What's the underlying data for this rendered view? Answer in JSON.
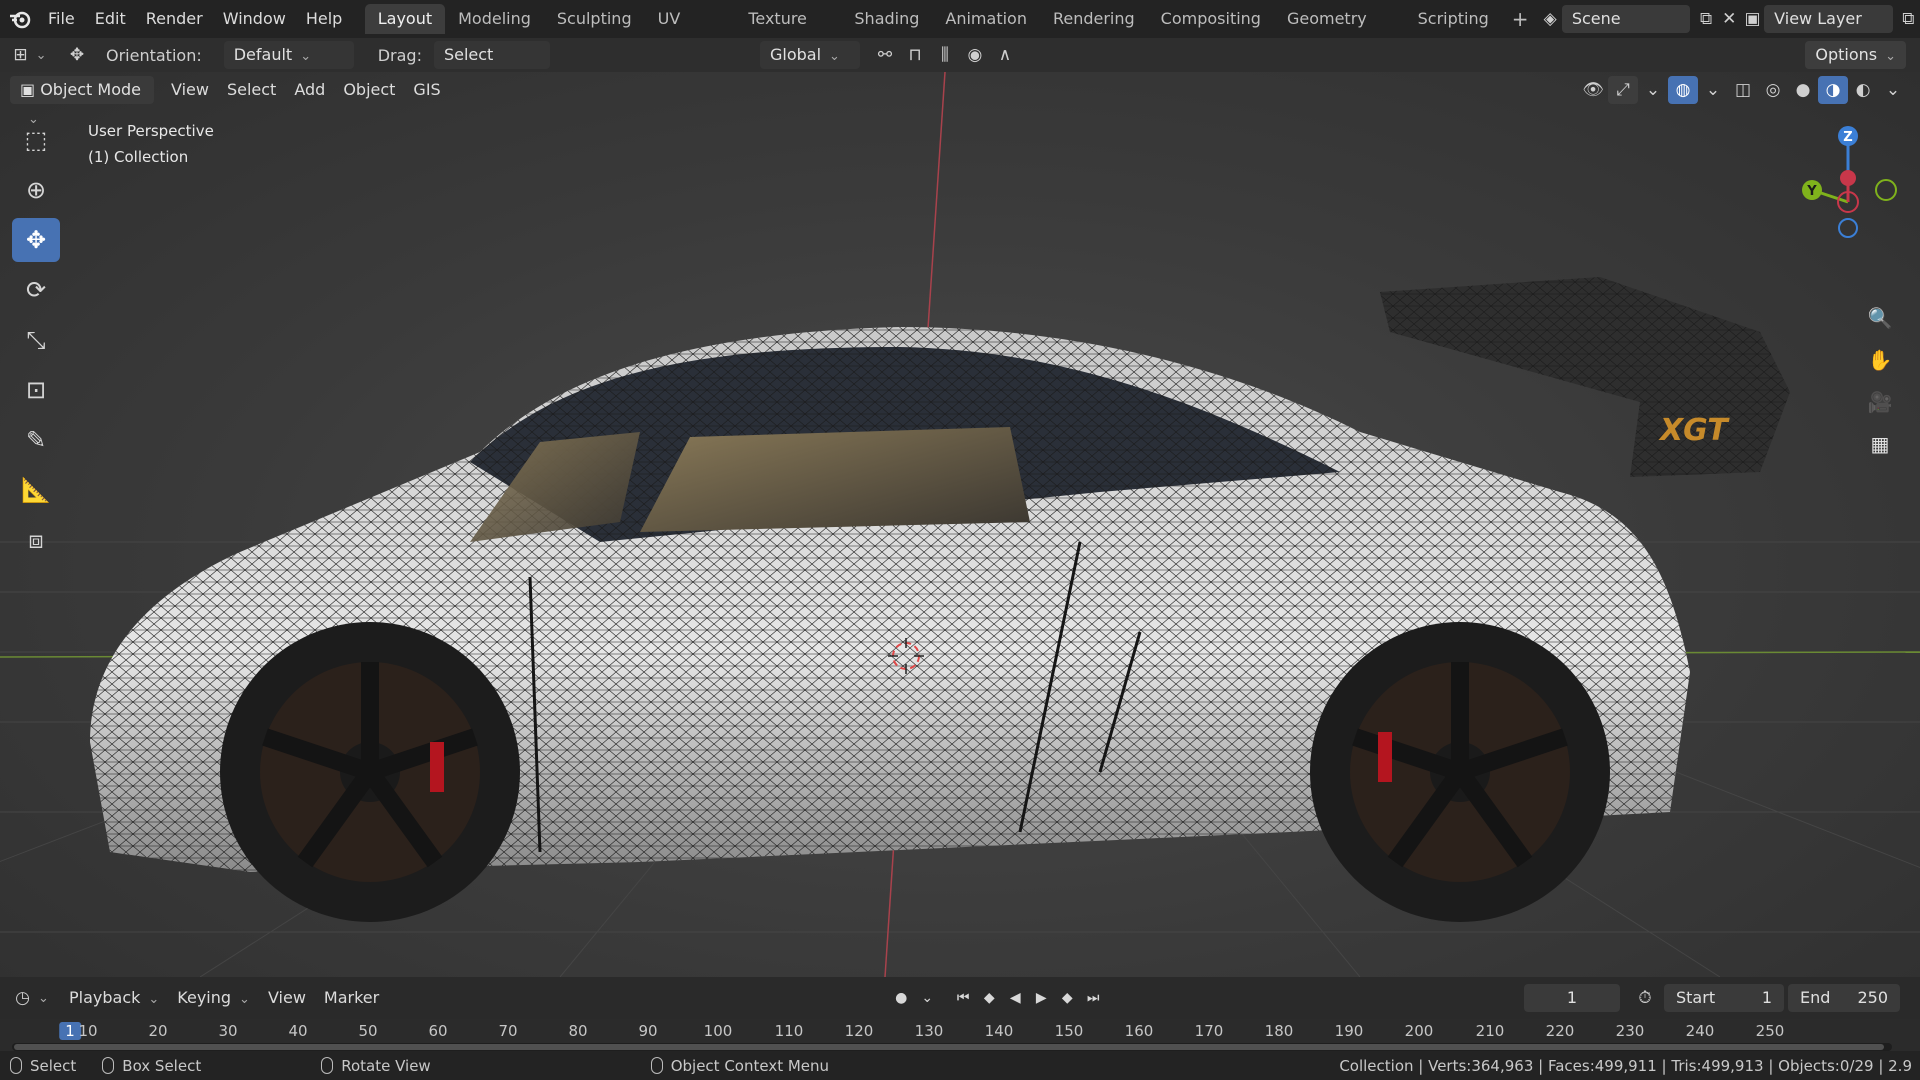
{
  "app": {
    "logo_icon": "blender-logo-icon"
  },
  "top_menu": [
    "File",
    "Edit",
    "Render",
    "Window",
    "Help"
  ],
  "workspaces": {
    "active": "Layout",
    "tabs": [
      "Layout",
      "Modeling",
      "Sculpting",
      "UV Editing",
      "Texture Paint",
      "Shading",
      "Animation",
      "Rendering",
      "Compositing",
      "Geometry Nodes",
      "Scripting"
    ],
    "add_label": "+"
  },
  "scene": {
    "label": "Scene"
  },
  "view_layer": {
    "label": "View Layer"
  },
  "tool_header": {
    "orientation_label": "Orientation:",
    "orientation_value": "Default",
    "drag_label": "Drag:",
    "drag_value": "Select Box",
    "transform_orientation": "Global",
    "options_label": "Options"
  },
  "viewport_header": {
    "mode": "Object Mode",
    "menus": [
      "View",
      "Select",
      "Add",
      "Object",
      "GIS"
    ]
  },
  "viewport_overlay": {
    "perspective": "User Perspective",
    "collection": "(1) Collection"
  },
  "gizmo": {
    "z": "Z",
    "y": "Y"
  },
  "timeline": {
    "menus": [
      "Playback",
      "Keying",
      "View",
      "Marker"
    ],
    "current_frame": "1",
    "start_label": "Start",
    "start_value": "1",
    "end_label": "End",
    "end_value": "250",
    "ticks": [
      "1",
      "10",
      "20",
      "30",
      "40",
      "50",
      "60",
      "70",
      "80",
      "90",
      "100",
      "110",
      "120",
      "130",
      "140",
      "150",
      "160",
      "170",
      "180",
      "190",
      "200",
      "210",
      "220",
      "230",
      "240",
      "250"
    ]
  },
  "statusbar": {
    "select": "Select",
    "box_select": "Box Select",
    "rotate_view": "Rotate View",
    "context_menu": "Object Context Menu",
    "stats": "Collection | Verts:364,963 | Faces:499,911 | Tris:499,913 | Objects:0/29 | 2.9"
  },
  "colors": {
    "accent": "#4772b3",
    "x_axis": "#c8374a",
    "y_axis": "#7fb21c",
    "z_axis": "#3b7fd6"
  }
}
